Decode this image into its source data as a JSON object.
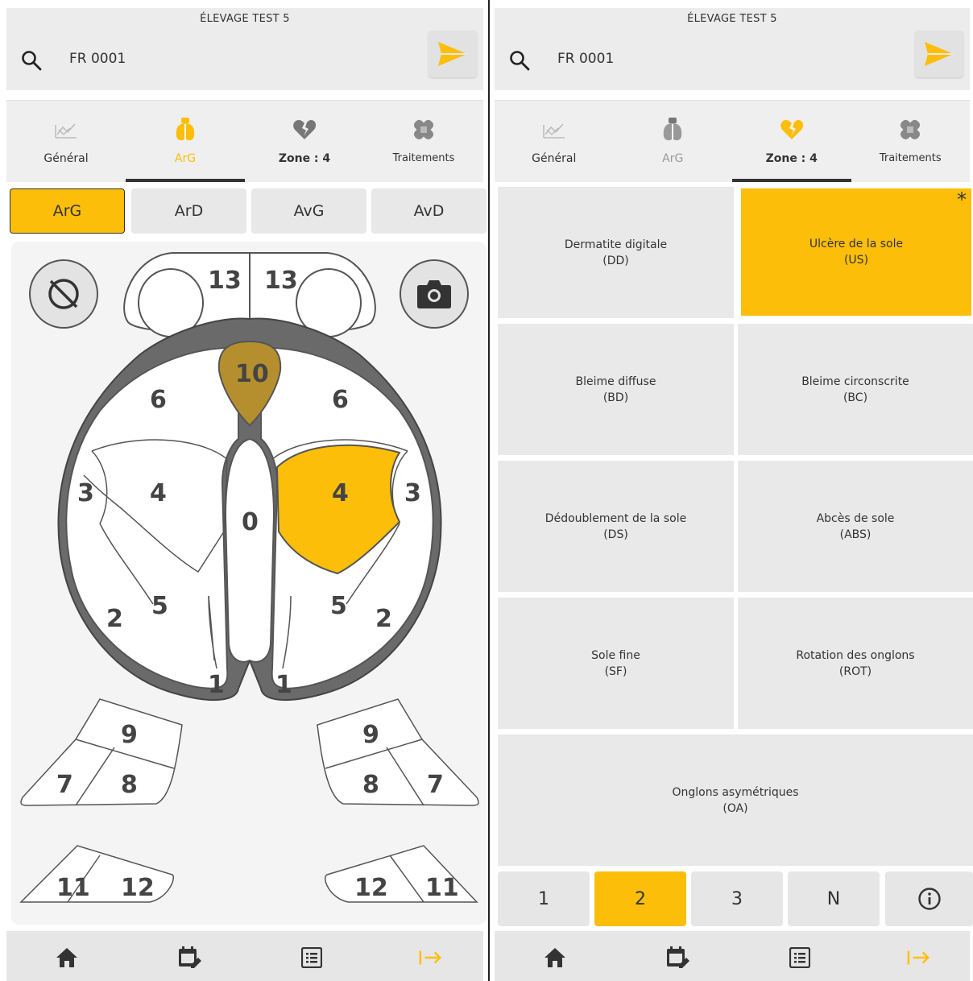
{
  "colors": {
    "accent": "#fdbe0a",
    "dark": "#333333",
    "zone_selected": "#fdbe0a",
    "zone_dimmed": "#b58f2e",
    "sole_outline": "#6a6a6a"
  },
  "left": {
    "header": {
      "title": "ÉLEVAGE TEST 5",
      "search_value": "FR 0001",
      "search_icon": "search-icon",
      "send_icon": "send-icon"
    },
    "tabs": [
      {
        "label": "Général",
        "icon": "chart-icon",
        "active": false
      },
      {
        "label": "ArG",
        "icon": "hoof-icon",
        "active": true
      },
      {
        "label": "Zone : 4",
        "icon": "broken-heart-icon",
        "active": false
      },
      {
        "label": "Traitements",
        "icon": "bandage-icon",
        "active": false
      }
    ],
    "feet": [
      {
        "label": "ArG",
        "active": true
      },
      {
        "label": "ArD",
        "active": false
      },
      {
        "label": "AvG",
        "active": false
      },
      {
        "label": "AvD",
        "active": false
      }
    ],
    "zones": {
      "z13a": "13",
      "z13b": "13",
      "z10": "10",
      "z6a": "6",
      "z6b": "6",
      "z3a": "3",
      "z4a": "4",
      "z0": "0",
      "z4b": "4",
      "z3b": "3",
      "z5a": "5",
      "z5b": "5",
      "z2a": "2",
      "z2b": "2",
      "z1a": "1",
      "z1b": "1",
      "z9a": "9",
      "z7a": "7",
      "z8a": "8",
      "z9b": "9",
      "z8b": "8",
      "z7b": "7",
      "z11a": "11",
      "z12a": "12",
      "z12b": "12",
      "z11b": "11"
    },
    "selected_zone": "4",
    "bottom_nav": [
      "home-icon",
      "calendar-edit-icon",
      "list-icon",
      "exit-icon"
    ]
  },
  "right": {
    "header": {
      "title": "ÉLEVAGE TEST 5",
      "search_value": "FR 0001"
    },
    "tabs": [
      {
        "label": "Général",
        "active": false
      },
      {
        "label": "ArG",
        "active": false
      },
      {
        "label": "Zone : 4",
        "active": true
      },
      {
        "label": "Traitements",
        "active": false
      }
    ],
    "lesions": [
      {
        "name": "Dermatite digitale",
        "code": "(DD)",
        "selected": false
      },
      {
        "name": "Ulcère de la sole",
        "code": "(US)",
        "selected": true,
        "marker": "*"
      },
      {
        "name": "Bleime diffuse",
        "code": "(BD)",
        "selected": false
      },
      {
        "name": "Bleime circonscrite",
        "code": "(BC)",
        "selected": false
      },
      {
        "name": "Dédoublement de la sole",
        "code": "(DS)",
        "selected": false
      },
      {
        "name": "Abcès de sole",
        "code": "(ABS)",
        "selected": false
      },
      {
        "name": "Sole fine",
        "code": "(SF)",
        "selected": false
      },
      {
        "name": "Rotation des onglons",
        "code": "(ROT)",
        "selected": false
      },
      {
        "name": "Onglons asymétriques",
        "code": "(OA)",
        "selected": false
      }
    ],
    "grades": [
      {
        "label": "1",
        "selected": false
      },
      {
        "label": "2",
        "selected": true
      },
      {
        "label": "3",
        "selected": false
      },
      {
        "label": "N",
        "selected": false
      }
    ],
    "info_icon": "info-icon"
  }
}
